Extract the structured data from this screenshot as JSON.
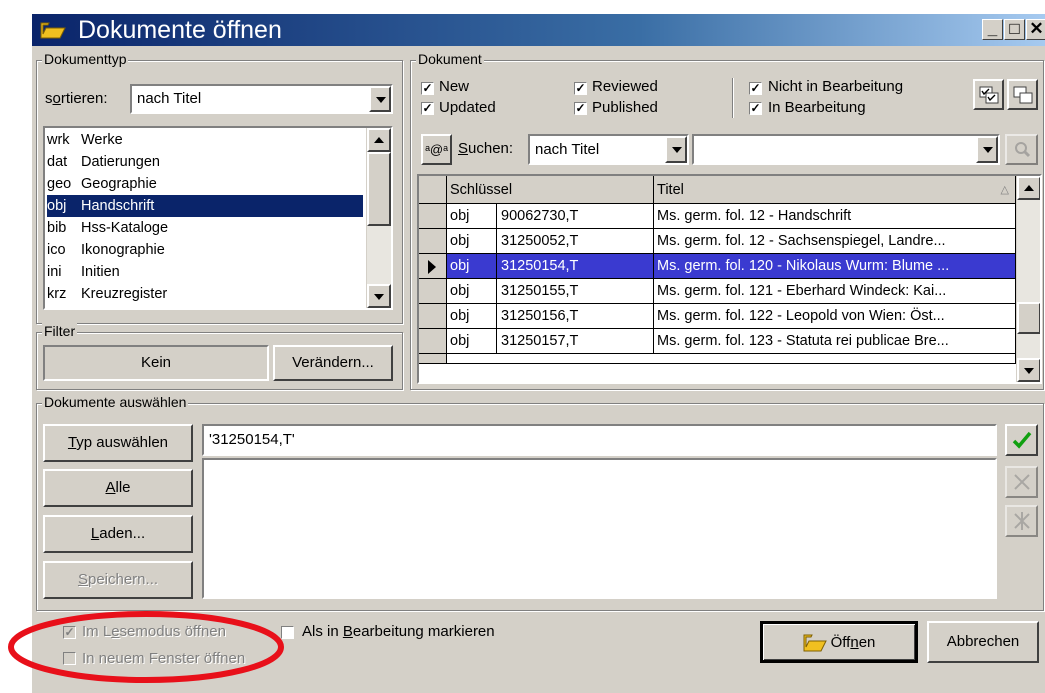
{
  "window": {
    "title": "Dokumente öffnen"
  },
  "dokumenttyp": {
    "group_label": "Dokumenttyp",
    "sort_label": "sortieren:",
    "sort_value": "nach Titel",
    "items": [
      {
        "code": "wrk",
        "name": "Werke"
      },
      {
        "code": "dat",
        "name": "Datierungen"
      },
      {
        "code": "geo",
        "name": "Geographie"
      },
      {
        "code": "obj",
        "name": "Handschrift"
      },
      {
        "code": "bib",
        "name": "Hss-Kataloge"
      },
      {
        "code": "ico",
        "name": "Ikonographie"
      },
      {
        "code": "ini",
        "name": "Initien"
      },
      {
        "code": "krz",
        "name": "Kreuzregister"
      }
    ],
    "selected_index": 3
  },
  "filter": {
    "group_label": "Filter",
    "value": "Kein",
    "change_button": "Verändern..."
  },
  "dokument": {
    "group_label": "Dokument",
    "checks": {
      "new": "New",
      "updated": "Updated",
      "reviewed": "Reviewed",
      "published": "Published",
      "nicht_in_bearbeitung": "Nicht in Bearbeitung",
      "in_bearbeitung": "In Bearbeitung"
    },
    "search_label": "Suchen:",
    "search_mode": "nach Titel",
    "search_value": "",
    "columns": {
      "key": "Schlüssel",
      "title": "Titel"
    },
    "rows": [
      {
        "type": "obj",
        "key": "90062730,T",
        "title": "Ms. germ. fol. 12 - Handschrift"
      },
      {
        "type": "obj",
        "key": "31250052,T",
        "title": "Ms. germ. fol. 12 - Sachsenspiegel, Landre..."
      },
      {
        "type": "obj",
        "key": "31250154,T",
        "title": "Ms. germ. fol. 120 - Nikolaus Wurm: Blume ..."
      },
      {
        "type": "obj",
        "key": "31250155,T",
        "title": "Ms. germ. fol. 121 - Eberhard Windeck: Kai..."
      },
      {
        "type": "obj",
        "key": "31250156,T",
        "title": "Ms. germ. fol. 122 - Leopold von Wien: Öst..."
      },
      {
        "type": "obj",
        "key": "31250157,T",
        "title": "Ms. germ. fol. 123 - Statuta rei publicae Bre..."
      }
    ],
    "selected_row": 2
  },
  "auswahl": {
    "group_label": "Dokumente auswählen",
    "btn_typ": "Typ auswählen",
    "btn_alle": "Alle",
    "btn_laden": "Laden...",
    "btn_speichern": "Speichern...",
    "input_value": "'31250154,T'"
  },
  "options": {
    "lesemodus": "Im Lesemodus öffnen",
    "bearbeitung": "Als in Bearbeitung markieren",
    "neues_fenster": "In neuem Fenster öffnen"
  },
  "actions": {
    "open": "Öffnen",
    "cancel": "Abbrechen"
  },
  "colors": {
    "selection": "#0a246a",
    "grid_selection": "#3a3ad0",
    "annotation": "#e8101a",
    "check": "#10a010"
  }
}
